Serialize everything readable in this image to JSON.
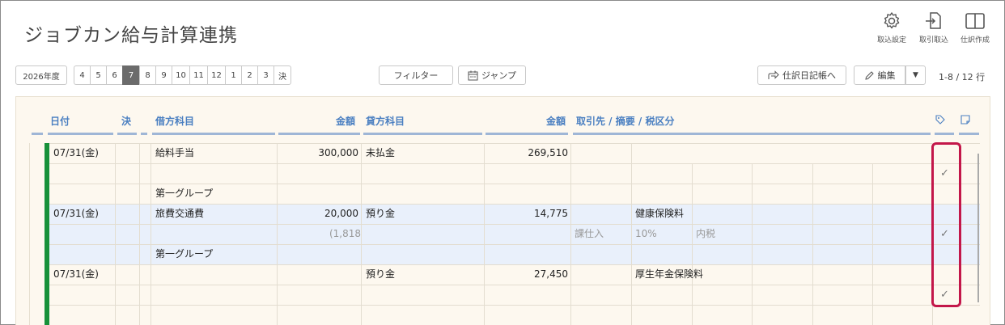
{
  "app": {
    "title": "ジョブカン給与計算連携"
  },
  "tools": [
    {
      "label": "取込設定",
      "icon": "gear-icon"
    },
    {
      "label": "取引取込",
      "icon": "import-file-icon"
    },
    {
      "label": "仕訳作成",
      "icon": "columns-icon"
    }
  ],
  "toolbar": {
    "year": "2026年度",
    "months": [
      "4",
      "5",
      "6",
      "7",
      "8",
      "9",
      "10",
      "11",
      "12",
      "1",
      "2",
      "3",
      "決"
    ],
    "active_month": "7",
    "filter_label": "フィルター",
    "jump_label": "ジャンプ",
    "journal_label": "仕訳日記帳へ",
    "edit_label": "編集",
    "count": "1-8 / 12 行"
  },
  "table": {
    "headers": {
      "date": "日付",
      "settle": "決",
      "debit_account": "借方科目",
      "debit_amount": "金額",
      "credit_account": "貸方科目",
      "credit_amount": "金額",
      "partner": "取引先 / 摘要 / 税区分"
    },
    "entries": [
      {
        "date": "07/31(金)",
        "debit_account": "給料手当",
        "debit_amount": "300,000",
        "credit_account": "未払金",
        "credit_amount": "269,510",
        "desc": "",
        "tax_type": "",
        "tax_rate": "",
        "tax_incl": "",
        "tax_amount": "",
        "group": "第一グループ",
        "checked": true
      },
      {
        "date": "07/31(金)",
        "debit_account": "旅費交通費",
        "debit_amount": "20,000",
        "credit_account": "預り金",
        "credit_amount": "14,775",
        "desc": "健康保険料",
        "tax_type": "課仕入",
        "tax_rate": "10%",
        "tax_incl": "内税",
        "tax_amount": "(1,818",
        "group": "第一グループ",
        "checked": true
      },
      {
        "date": "07/31(金)",
        "debit_account": "",
        "debit_amount": "",
        "credit_account": "預り金",
        "credit_amount": "27,450",
        "desc": "厚生年金保険料",
        "tax_type": "",
        "tax_rate": "",
        "tax_incl": "",
        "tax_amount": "",
        "group": "",
        "checked": true
      }
    ],
    "check_mark": "✓"
  },
  "colors": {
    "accent": "#4a7fc1",
    "green": "#17913a",
    "highlight": "#c3174a",
    "row_blue": "#e9f0fb",
    "panel": "#fdf8ef"
  }
}
